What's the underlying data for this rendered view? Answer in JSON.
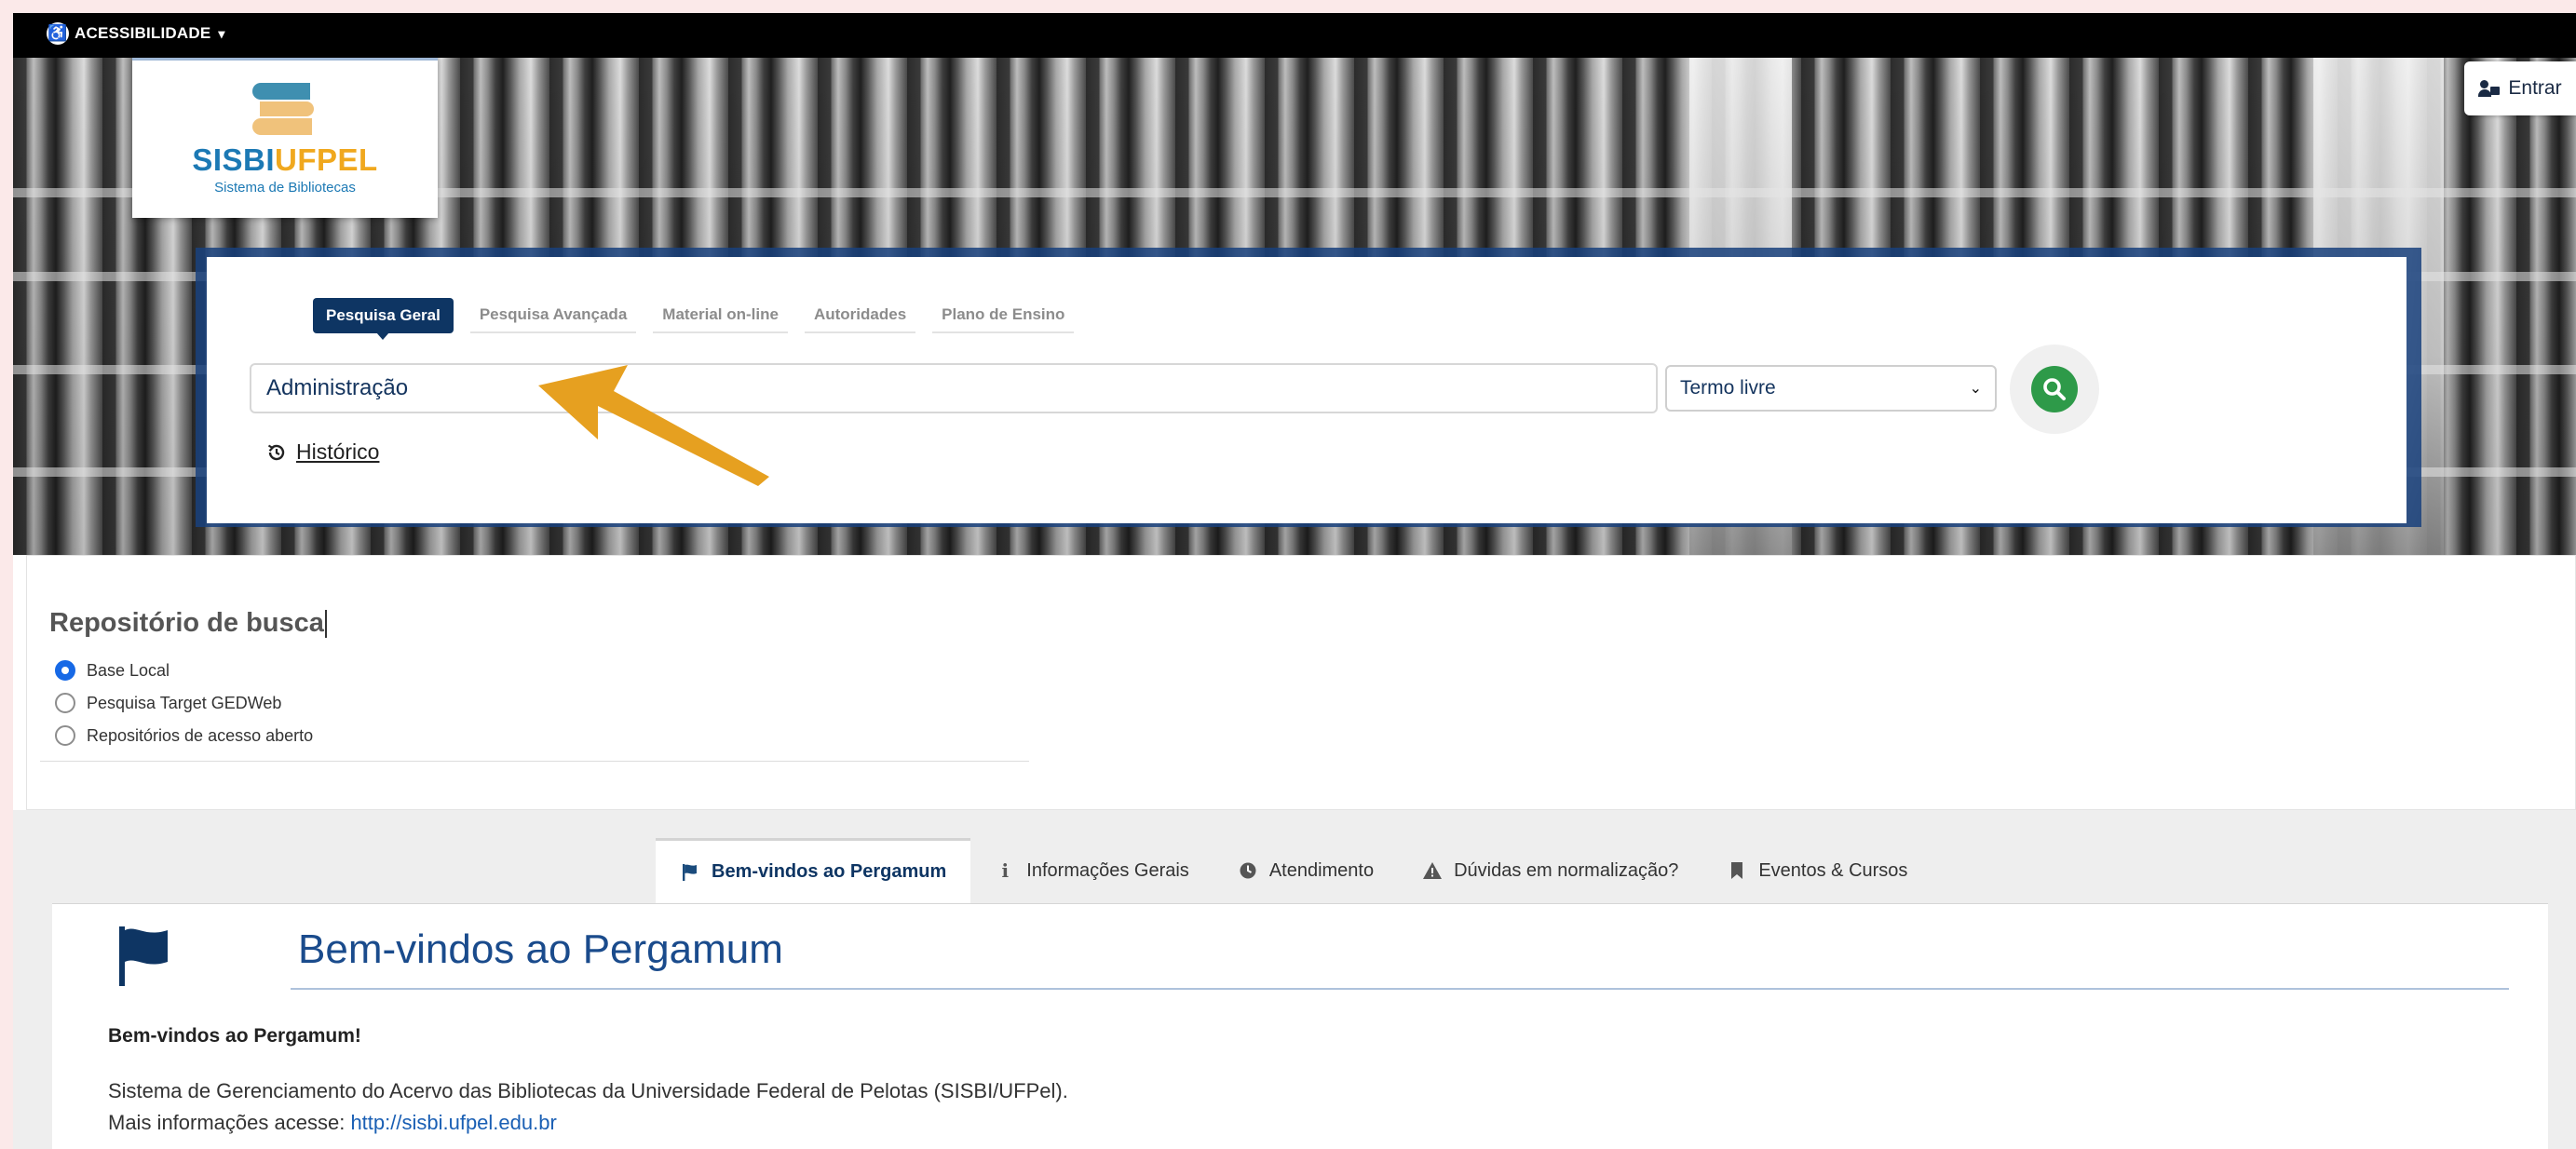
{
  "accessibility": {
    "label": "ACESSIBILIDADE",
    "icon": "accessibility-icon"
  },
  "logo": {
    "brand_part1": "SISBI",
    "brand_part2": "UFPEL",
    "subtitle": "Sistema de Bibliotecas"
  },
  "login": {
    "label": "Entrar",
    "icon": "user-lock-icon"
  },
  "search": {
    "tabs": [
      {
        "label": "Pesquisa Geral",
        "active": true
      },
      {
        "label": "Pesquisa Avançada",
        "active": false
      },
      {
        "label": "Material on-line",
        "active": false
      },
      {
        "label": "Autoridades",
        "active": false
      },
      {
        "label": "Plano de Ensino",
        "active": false
      }
    ],
    "query_value": "Administração",
    "field_selected": "Termo livre",
    "search_icon": "search-icon",
    "history_label": "Histórico",
    "history_icon": "history-icon"
  },
  "repository": {
    "title": "Repositório de busca",
    "options": [
      {
        "label": "Base Local",
        "selected": true
      },
      {
        "label": "Pesquisa Target GEDWeb",
        "selected": false
      },
      {
        "label": "Repositórios de acesso aberto",
        "selected": false
      }
    ]
  },
  "info_tabs": [
    {
      "label": "Bem-vindos ao Pergamum",
      "icon": "flag-icon",
      "active": true
    },
    {
      "label": "Informações Gerais",
      "icon": "info-icon",
      "active": false
    },
    {
      "label": "Atendimento",
      "icon": "clock-icon",
      "active": false
    },
    {
      "label": "Dúvidas em normalização?",
      "icon": "warning-icon",
      "active": false
    },
    {
      "label": "Eventos & Cursos",
      "icon": "bookmark-icon",
      "active": false
    }
  ],
  "welcome": {
    "title": "Bem-vindos ao Pergamum",
    "bold_line": "Bem-vindos ao Pergamum!",
    "text1": "Sistema de Gerenciamento do Acervo das Bibliotecas da Universidade Federal de Pelotas (SISBI/UFPel).",
    "text2_prefix": "Mais informações acesse: ",
    "link": "http://sisbi.ufpel.edu.br"
  },
  "colors": {
    "primary": "#0e3563",
    "accent_orange": "#e6a020",
    "search_green": "#2e9a49",
    "link": "#1a5fb4"
  }
}
